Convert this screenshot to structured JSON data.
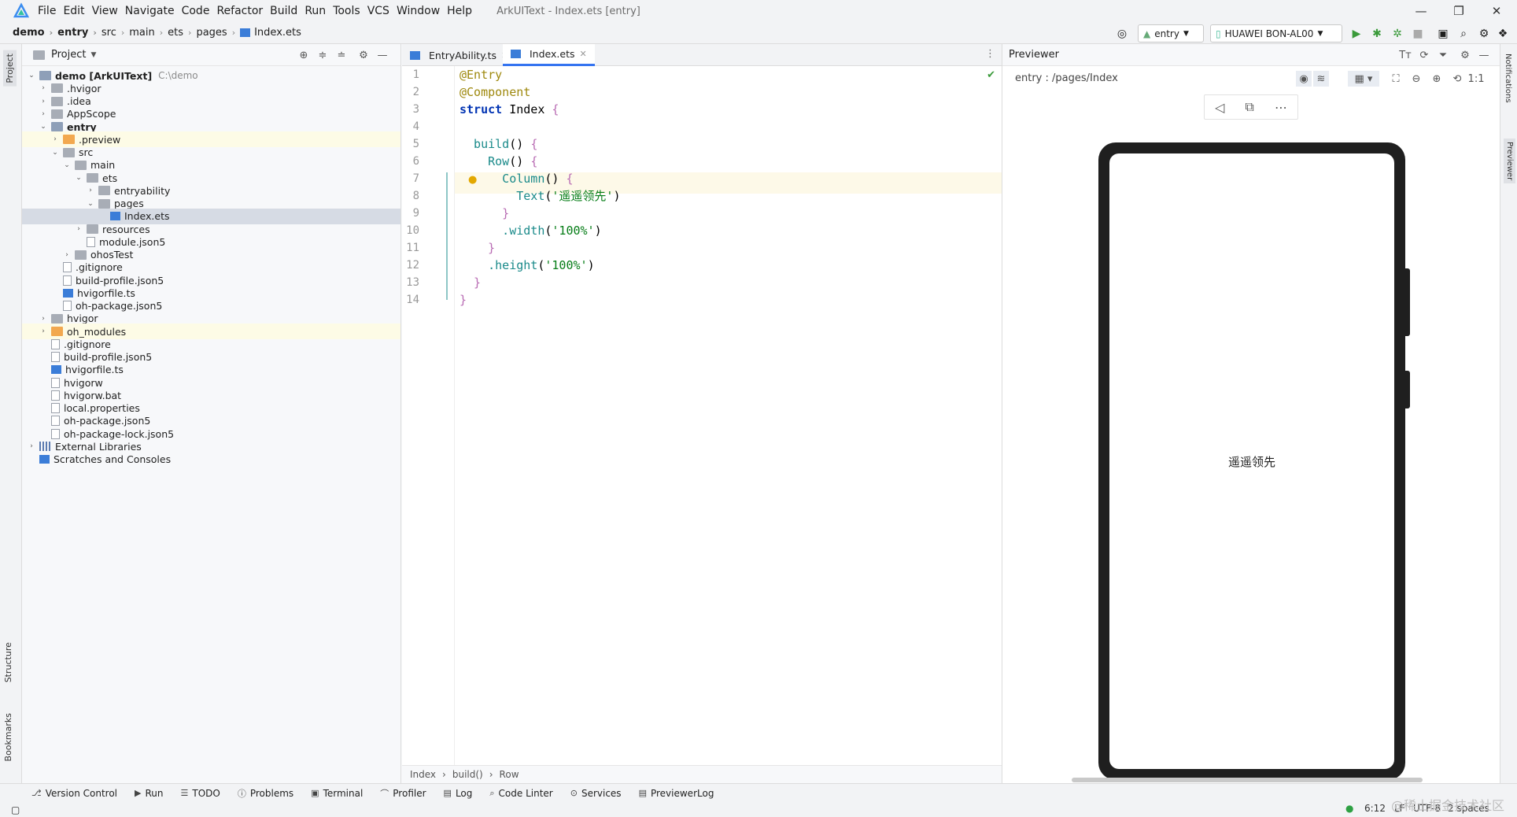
{
  "menubar": {
    "items": [
      "File",
      "Edit",
      "View",
      "Navigate",
      "Code",
      "Refactor",
      "Build",
      "Run",
      "Tools",
      "VCS",
      "Window",
      "Help"
    ],
    "window_title": "ArkUIText - Index.ets [entry]",
    "minimize": "—",
    "maximize": "❐",
    "close": "✕"
  },
  "navbar": {
    "breadcrumbs": [
      "demo",
      "entry",
      "src",
      "main",
      "ets",
      "pages",
      "Index.ets"
    ],
    "module_select": "entry",
    "device_select": "HUAWEI BON-AL00"
  },
  "left_strip": {
    "project": "Project",
    "structure": "Structure",
    "bookmarks": "Bookmarks"
  },
  "right_strip": {
    "notifications": "Notifications",
    "previewer": "Previewer"
  },
  "project_panel": {
    "title": "Project",
    "tree": [
      {
        "label": "demo [ArkUIText]",
        "note": "C:\\demo",
        "depth": 0,
        "toggle": "open",
        "icon": "folder-mod",
        "bold": true
      },
      {
        "label": ".hvigor",
        "depth": 1,
        "toggle": "closed",
        "icon": "folder"
      },
      {
        "label": ".idea",
        "depth": 1,
        "toggle": "closed",
        "icon": "folder"
      },
      {
        "label": "AppScope",
        "depth": 1,
        "toggle": "closed",
        "icon": "folder"
      },
      {
        "label": "entry",
        "depth": 1,
        "toggle": "open",
        "icon": "folder-mod",
        "bold": true
      },
      {
        "label": ".preview",
        "depth": 2,
        "toggle": "closed",
        "icon": "folder-orange",
        "highlight": true
      },
      {
        "label": "src",
        "depth": 2,
        "toggle": "open",
        "icon": "folder"
      },
      {
        "label": "main",
        "depth": 3,
        "toggle": "open",
        "icon": "folder"
      },
      {
        "label": "ets",
        "depth": 4,
        "toggle": "open",
        "icon": "folder"
      },
      {
        "label": "entryability",
        "depth": 5,
        "toggle": "closed",
        "icon": "folder"
      },
      {
        "label": "pages",
        "depth": 5,
        "toggle": "open",
        "icon": "folder"
      },
      {
        "label": "Index.ets",
        "depth": 6,
        "toggle": "none",
        "icon": "ts",
        "selected": true
      },
      {
        "label": "resources",
        "depth": 4,
        "toggle": "closed",
        "icon": "folder"
      },
      {
        "label": "module.json5",
        "depth": 4,
        "toggle": "none",
        "icon": "file"
      },
      {
        "label": "ohosTest",
        "depth": 3,
        "toggle": "closed",
        "icon": "folder"
      },
      {
        "label": ".gitignore",
        "depth": 2,
        "toggle": "none",
        "icon": "file"
      },
      {
        "label": "build-profile.json5",
        "depth": 2,
        "toggle": "none",
        "icon": "file"
      },
      {
        "label": "hvigorfile.ts",
        "depth": 2,
        "toggle": "none",
        "icon": "ts"
      },
      {
        "label": "oh-package.json5",
        "depth": 2,
        "toggle": "none",
        "icon": "file"
      },
      {
        "label": "hvigor",
        "depth": 1,
        "toggle": "closed",
        "icon": "folder"
      },
      {
        "label": "oh_modules",
        "depth": 1,
        "toggle": "closed",
        "icon": "folder-orange",
        "highlight": true
      },
      {
        "label": ".gitignore",
        "depth": 1,
        "toggle": "none",
        "icon": "file"
      },
      {
        "label": "build-profile.json5",
        "depth": 1,
        "toggle": "none",
        "icon": "file"
      },
      {
        "label": "hvigorfile.ts",
        "depth": 1,
        "toggle": "none",
        "icon": "ts"
      },
      {
        "label": "hvigorw",
        "depth": 1,
        "toggle": "none",
        "icon": "file"
      },
      {
        "label": "hvigorw.bat",
        "depth": 1,
        "toggle": "none",
        "icon": "file"
      },
      {
        "label": "local.properties",
        "depth": 1,
        "toggle": "none",
        "icon": "file"
      },
      {
        "label": "oh-package.json5",
        "depth": 1,
        "toggle": "none",
        "icon": "file"
      },
      {
        "label": "oh-package-lock.json5",
        "depth": 1,
        "toggle": "none",
        "icon": "file"
      },
      {
        "label": "External Libraries",
        "depth": 0,
        "toggle": "closed",
        "icon": "lib"
      },
      {
        "label": "Scratches and Consoles",
        "depth": 0,
        "toggle": "none",
        "icon": "scratch"
      }
    ]
  },
  "editor": {
    "tabs": [
      {
        "label": "EntryAbility.ts",
        "active": false
      },
      {
        "label": "Index.ets",
        "active": true
      }
    ],
    "lines": [
      [
        [
          "kw-dec",
          "@Entry"
        ]
      ],
      [
        [
          "kw-dec",
          "@Component"
        ]
      ],
      [
        [
          "kw",
          "struct"
        ],
        [
          "ty",
          " Index "
        ],
        [
          "punc",
          "{"
        ]
      ],
      [],
      [
        [
          "fn",
          "  build"
        ],
        [
          "ty",
          "() "
        ],
        [
          "punc",
          "{"
        ]
      ],
      [
        [
          "fn",
          "    Row"
        ],
        [
          "ty",
          "() "
        ],
        [
          "punc",
          "{"
        ]
      ],
      [
        [
          "fn",
          "      Column"
        ],
        [
          "ty",
          "() "
        ],
        [
          "punc",
          "{"
        ]
      ],
      [
        [
          "fn",
          "        Text"
        ],
        [
          "ty",
          "("
        ],
        [
          "str",
          "'遥遥领先'"
        ],
        [
          "ty",
          ")"
        ]
      ],
      [
        [
          "punc",
          "      }"
        ]
      ],
      [
        [
          "fn",
          "      .width"
        ],
        [
          "ty",
          "("
        ],
        [
          "str",
          "'100%'"
        ],
        [
          "ty",
          ")"
        ]
      ],
      [
        [
          "punc",
          "    }"
        ]
      ],
      [
        [
          "fn",
          "    .height"
        ],
        [
          "ty",
          "("
        ],
        [
          "str",
          "'100%'"
        ],
        [
          "ty",
          ")"
        ]
      ],
      [
        [
          "punc",
          "  }"
        ]
      ],
      [
        [
          "punc",
          "}"
        ]
      ]
    ],
    "breadcrumbs": [
      "Index",
      "build()",
      "Row"
    ]
  },
  "previewer": {
    "title": "Previewer",
    "path": "entry : /pages/Index",
    "screen_text": "遥遥领先",
    "zoom_label": "1:1"
  },
  "bottom_tabs": [
    "Version Control",
    "Run",
    "TODO",
    "Problems",
    "Terminal",
    "Profiler",
    "Log",
    "Code Linter",
    "Services",
    "PreviewerLog"
  ],
  "statusbar": {
    "position": "6:12",
    "line_sep": "LF",
    "encoding": "UTF-8",
    "indent": "2 spaces"
  },
  "watermark": "@稀土掘金技术社区"
}
